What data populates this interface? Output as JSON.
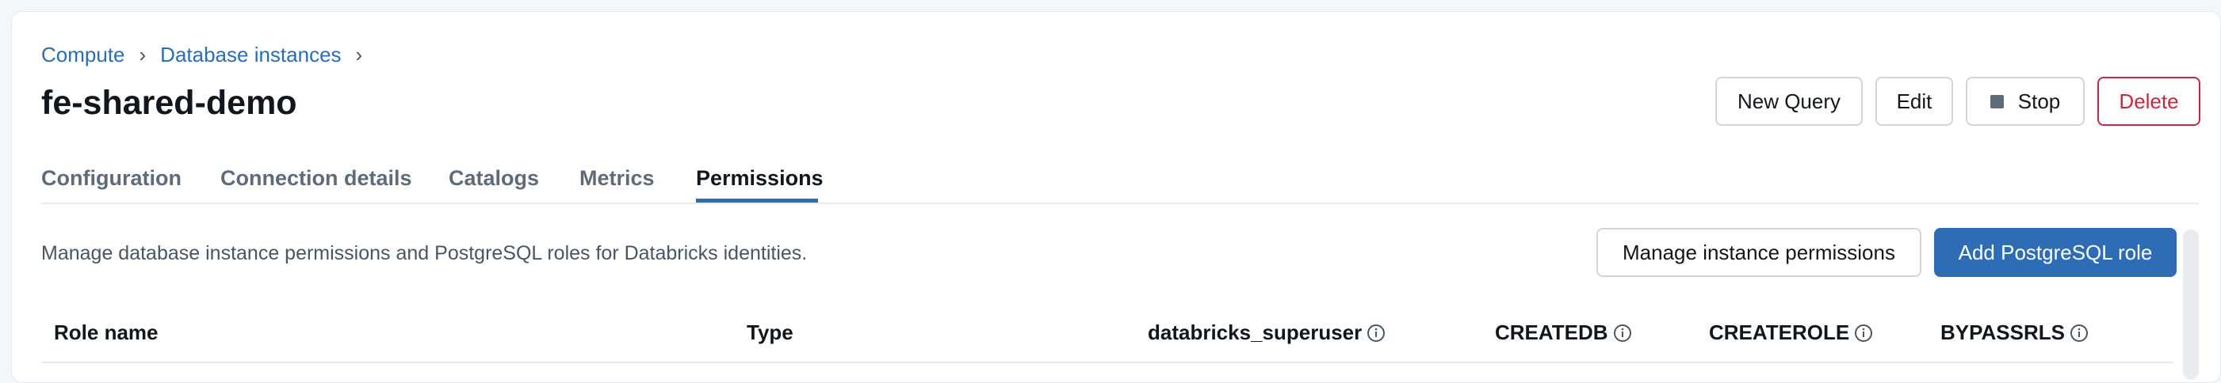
{
  "breadcrumb": {
    "items": [
      "Compute",
      "Database instances"
    ],
    "separator": "›"
  },
  "page": {
    "title": "fe-shared-demo"
  },
  "header_actions": {
    "new_query": "New Query",
    "edit": "Edit",
    "stop": "Stop",
    "delete": "Delete"
  },
  "tabs": {
    "items": [
      "Configuration",
      "Connection details",
      "Catalogs",
      "Metrics",
      "Permissions"
    ],
    "active": "Permissions"
  },
  "permissions": {
    "description": "Manage database instance permissions and PostgreSQL roles for Databricks identities.",
    "manage_button": "Manage instance permissions",
    "add_role_button": "Add PostgreSQL role"
  },
  "table": {
    "columns": [
      "Role name",
      "Type",
      "databricks_superuser",
      "CREATEDB",
      "CREATEROLE",
      "BYPASSRLS"
    ]
  },
  "colors": {
    "link": "#2a6db5",
    "primary": "#2e6db5",
    "danger": "#c8283f",
    "muted_text": "#5f6b78"
  },
  "icons": {
    "stop": "stop-square-icon",
    "info": "info-circle-icon",
    "breadcrumb_separator": "chevron-right-icon"
  }
}
